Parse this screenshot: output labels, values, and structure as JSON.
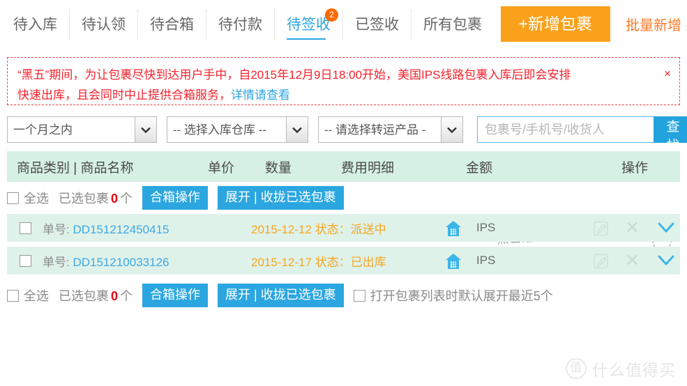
{
  "tabs": [
    {
      "label": "待入库",
      "active": false
    },
    {
      "label": "待认领",
      "active": false
    },
    {
      "label": "待合箱",
      "active": false
    },
    {
      "label": "待付款",
      "active": false
    },
    {
      "label": "待签收",
      "active": true,
      "badge": "2"
    },
    {
      "label": "已签收",
      "active": false
    },
    {
      "label": "所有包裹",
      "active": false
    }
  ],
  "header_actions": {
    "add_label": "+新增包裹",
    "bulk_label": "批量新增"
  },
  "alert": {
    "line1": "“黑五”期间，为让包裹尽快到达用户手中，自2015年12月9日18:00开始，美国IPS线路包裹入库后即会安排",
    "line2_prefix": "快速出库，且会同时中止提供合箱服务，",
    "line2_link": "详情请查看",
    "close_label": "×"
  },
  "filters": {
    "period": {
      "value": "一个月之内"
    },
    "warehouse": {
      "value": "-- 选择入库仓库 --"
    },
    "product": {
      "value": "-- 请选择转运产品 -"
    },
    "search": {
      "placeholder": "包裹号/手机号/收货人",
      "value": "",
      "button_label": "查找"
    }
  },
  "table_header": {
    "col_name": "商品类别 | 商品名称",
    "col_price": "单价",
    "col_qty": "数量",
    "col_fee": "费用明细",
    "col_amount": "金额",
    "col_action": "操作"
  },
  "toolbar": {
    "select_all_label": "全选",
    "selected_prefix": "已选包裹",
    "selected_count": "0",
    "selected_suffix": "个",
    "merge_label": "合箱操作",
    "expand_label": "展开 | 收拢已选包裹",
    "auto_expand_label": "打开包裹列表时默认展开最近5个"
  },
  "annotation": {
    "text": "点击这里展开/收拢包裹详情"
  },
  "packages": [
    {
      "no_label": "单号:",
      "no": "DD151212450415",
      "date": "2015-12-12",
      "status_label": "状态：",
      "status": "派送中",
      "carrier": "IPS"
    },
    {
      "no_label": "单号:",
      "no": "DD151210033126",
      "date": "2015-12-17",
      "status_label": "状态：",
      "status": "已出库",
      "carrier": "IPS"
    }
  ],
  "watermark": {
    "logo": "值",
    "text": "什么值得买"
  },
  "colors": {
    "accent_blue": "#2ba6e0",
    "orange_button": "#f9a11b",
    "bulk_orange": "#ff7a29",
    "alert_red": "#f5222d",
    "row_green": "#dff2ea",
    "header_green": "#d6f0e4",
    "status_orange": "#f5a623",
    "badge_orange": "#ff6a00"
  }
}
